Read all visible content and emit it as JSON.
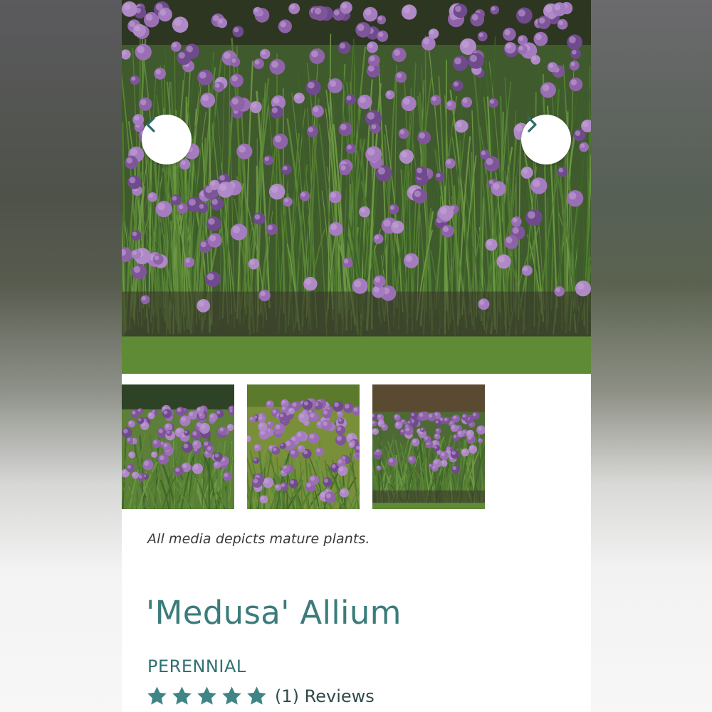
{
  "gallery": {
    "prev_label": "Previous image",
    "next_label": "Next image",
    "thumbnails": [
      "thumbnail-1",
      "thumbnail-2",
      "thumbnail-3"
    ]
  },
  "media_note": "All media depicts mature plants.",
  "product": {
    "title": "'Medusa' Allium",
    "category": "PERENNIAL",
    "rating": 5,
    "rating_max": 5,
    "reviews_text": "(1) Reviews"
  },
  "colors": {
    "accent": "#3c7b7c",
    "star": "#3f8585",
    "flower": "#8e63a8"
  },
  "icons": {
    "prev": "chevron-left-icon",
    "next": "chevron-right-icon",
    "star": "star-icon"
  }
}
